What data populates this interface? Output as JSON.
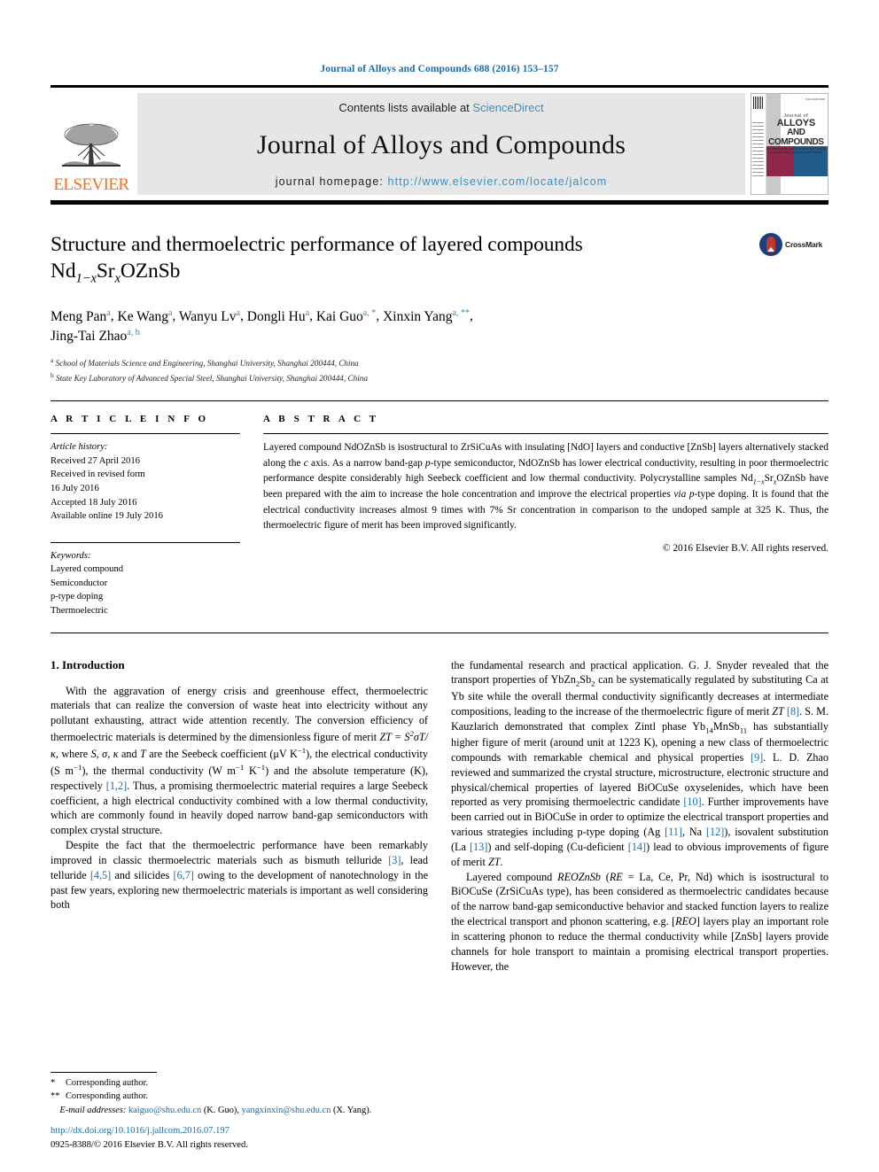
{
  "running_head": "Journal of Alloys and Compounds 688 (2016) 153–157",
  "masthead": {
    "contents_prefix": "Contents lists available at ",
    "sciencedirect": "ScienceDirect",
    "journal_title": "Journal of Alloys and Compounds",
    "homepage_prefix": "journal homepage: ",
    "homepage_url": "http://www.elsevier.com/locate/jalcom",
    "publisher": "ELSEVIER",
    "cover": {
      "line1": "Journal of",
      "line2": "ALLOYS",
      "line3": "AND COMPOUNDS",
      "line4": "An International Journal of Materials Science and Solid State Chemistry and Physics",
      "corner_note": "ISSN 0925-8388"
    }
  },
  "title": {
    "line1": "Structure and thermoelectric performance of layered compounds",
    "formula_prefix": "Nd",
    "formula_sub1": "1−x",
    "formula_mid": "Sr",
    "formula_sub2": "x",
    "formula_suffix": "OZnSb",
    "crossmark_label": "CrossMark"
  },
  "authors": {
    "list": "Meng Pan a, Ke Wang a, Wanyu Lv a, Dongli Hu a, Kai Guo a, *, Xinxin Yang a, **, Jing-Tai Zhao a, b",
    "names": [
      {
        "name": "Meng Pan",
        "sup": "a"
      },
      {
        "name": "Ke Wang",
        "sup": "a"
      },
      {
        "name": "Wanyu Lv",
        "sup": "a"
      },
      {
        "name": "Dongli Hu",
        "sup": "a"
      },
      {
        "name": "Kai Guo",
        "sup": "a, *"
      },
      {
        "name": "Xinxin Yang",
        "sup": "a, **"
      },
      {
        "name": "Jing-Tai Zhao",
        "sup": "a, b"
      }
    ],
    "affiliations": [
      {
        "marker": "a",
        "text": "School of Materials Science and Engineering, Shanghai University, Shanghai 200444, China"
      },
      {
        "marker": "b",
        "text": "State Key Laboratory of Advanced Special Steel, Shanghai University, Shanghai 200444, China"
      }
    ]
  },
  "article_info": {
    "heading": "A R T I C L E  I N F O",
    "history_label": "Article history:",
    "history": [
      "Received 27 April 2016",
      "Received in revised form",
      "16 July 2016",
      "Accepted 18 July 2016",
      "Available online 19 July 2016"
    ],
    "keywords_label": "Keywords:",
    "keywords": [
      "Layered compound",
      "Semiconductor",
      "p-type doping",
      "Thermoelectric"
    ]
  },
  "abstract": {
    "heading": "A B S T R A C T",
    "part1": "Layered compound NdOZnSb is isostructural to ZrSiCuAs with insulating [NdO] layers and conductive [ZnSb] layers alternatively stacked along the ",
    "c_axis": "c",
    "part2": " axis. As a narrow band-gap ",
    "p1": "p",
    "part3": "-type semiconductor, NdOZnSb has lower electrical conductivity, resulting in poor thermoelectric performance despite considerably high Seebeck coefficient and low thermal conductivity. Polycrystalline samples Nd",
    "sub1": "1−x",
    "part4": "Sr",
    "sub2": "x",
    "part5": "OZnSb have been prepared with the aim to increase the hole concentration and improve the electrical properties ",
    "via": "via",
    "part6": " ",
    "p2": "p",
    "part7": "-type doping. It is found that the electrical conductivity increases almost 9 times with 7% Sr concentration in comparison to the undoped sample at 325 K. Thus, the thermoelectric figure of merit has been improved significantly.",
    "copyright": "© 2016 Elsevier B.V. All rights reserved."
  },
  "body": {
    "section_title": "1. Introduction",
    "left": {
      "p1_a": "With the aggravation of energy crisis and greenhouse effect, thermoelectric materials that can realize the conversion of waste heat into electricity without any pollutant exhausting, attract wide attention recently. The conversion efficiency of thermoelectric materials is determined by the dimensionless figure of merit ",
      "zt_formula": "ZT = S",
      "zt_exp": "2",
      "zt_rest": "σT/κ",
      "p1_b": ", where ",
      "p1_sym1": "S",
      "p1_c": ", ",
      "p1_sym2": "σ",
      "p1_d": ", ",
      "p1_sym3": "κ",
      "p1_e": " and ",
      "p1_sym4": "T",
      "p1_f": " are the Seebeck coefficient (μV K",
      "p1_sup1": "−1",
      "p1_g": "), the electrical conductivity (S m",
      "p1_sup2": "−1",
      "p1_h": "), the thermal conductivity (W m",
      "p1_sup3": "−1",
      "p1_i": " K",
      "p1_sup4": "−1",
      "p1_j": ") and the absolute temperature (K), respectively ",
      "p1_ref": "[1,2]",
      "p1_k": ". Thus, a promising thermoelectric material requires a large Seebeck coefficient, a high electrical conductivity combined with a low thermal conductivity, which are commonly found in heavily doped narrow band-gap semiconductors with complex crystal structure.",
      "p2_a": "Despite the fact that the thermoelectric performance have been remarkably improved in classic thermoelectric materials such as bismuth telluride ",
      "p2_ref1": "[3]",
      "p2_b": ", lead telluride ",
      "p2_ref2": "[4,5]",
      "p2_c": " and silicides ",
      "p2_ref3": "[6,7]",
      "p2_d": " owing to the development of nanotechnology in the past few years, exploring new thermoelectric materials is important as well considering both"
    },
    "right": {
      "p1_a": "the fundamental research and practical application. G. J. Snyder revealed that the transport properties of YbZn",
      "p1_sub1": "2",
      "p1_b": "Sb",
      "p1_sub2": "2",
      "p1_c": " can be systematically regulated by substituting Ca at Yb site while the overall thermal conductivity significantly decreases at intermediate compositions, leading to the increase of the thermoelectric figure of merit ",
      "p1_zt": "ZT",
      "p1_d": " ",
      "p1_ref1": "[8]",
      "p1_e": ". S. M. Kauzlarich demonstrated that complex Zintl phase Yb",
      "p1_sub3": "14",
      "p1_f": "MnSb",
      "p1_sub4": "11",
      "p1_g": " has substantially higher figure of merit (around unit at 1223 K), opening a new class of thermoelectric compounds with remarkable chemical and physical properties ",
      "p1_ref2": "[9]",
      "p1_h": ". L. D. Zhao reviewed and summarized the crystal structure, microstructure, electronic structure and physical/chemical properties of layered BiOCuSe oxyselenides, which have been reported as very promising thermoelectric candidate ",
      "p1_ref3": "[10]",
      "p1_i": ". Further improvements have been carried out in BiOCuSe in order to optimize the electrical transport properties and various strategies including p-type doping (Ag ",
      "p1_ref4": "[11]",
      "p1_j": ", Na ",
      "p1_ref5": "[12]",
      "p1_k": "), isovalent substitution (La ",
      "p1_ref6": "[13]",
      "p1_l": ") and self-doping (Cu-deficient ",
      "p1_ref7": "[14]",
      "p1_m": ") lead to obvious improvements of figure of merit ",
      "p1_zt2": "ZT",
      "p1_n": ".",
      "p2_a": "Layered compound ",
      "p2_reozn": "REOZnSb",
      "p2_b": " (",
      "p2_re": "RE",
      "p2_c": " = La, Ce, Pr, Nd) which is isostructural to BiOCuSe (ZrSiCuAs type), has been considered as thermoelectric candidates because of the narrow band-gap semiconductive behavior and stacked function layers to realize the electrical transport and phonon scattering, e.g. [",
      "p2_reo": "REO",
      "p2_d": "] layers play an important role in scattering phonon to reduce the thermal conductivity while [ZnSb] layers provide channels for hole transport to maintain a promising electrical transport properties. However, the"
    }
  },
  "footnotes": {
    "star1": "*",
    "star1_text": "Corresponding author.",
    "star2": "**",
    "star2_text": "Corresponding author.",
    "email_label": "E-mail addresses:",
    "email1": "kaiguo@shu.edu.cn",
    "email1_owner": "(K. Guo)",
    "email2": "yangxinxin@shu.edu.cn",
    "email2_owner": "(X. Yang).",
    "comma": ","
  },
  "doi": {
    "url": "http://dx.doi.org/10.1016/j.jallcom.2016.07.197",
    "issn_line": "0925-8388/© 2016 Elsevier B.V. All rights reserved."
  },
  "colors": {
    "link": "#1b6ca8",
    "sciencedirect": "#3a8fbb",
    "elsevier_orange": "#f27021",
    "cover_maroon": "#8e2749",
    "cover_navy": "#1f5c8b",
    "masthead_bg": "#e6e6e6"
  }
}
